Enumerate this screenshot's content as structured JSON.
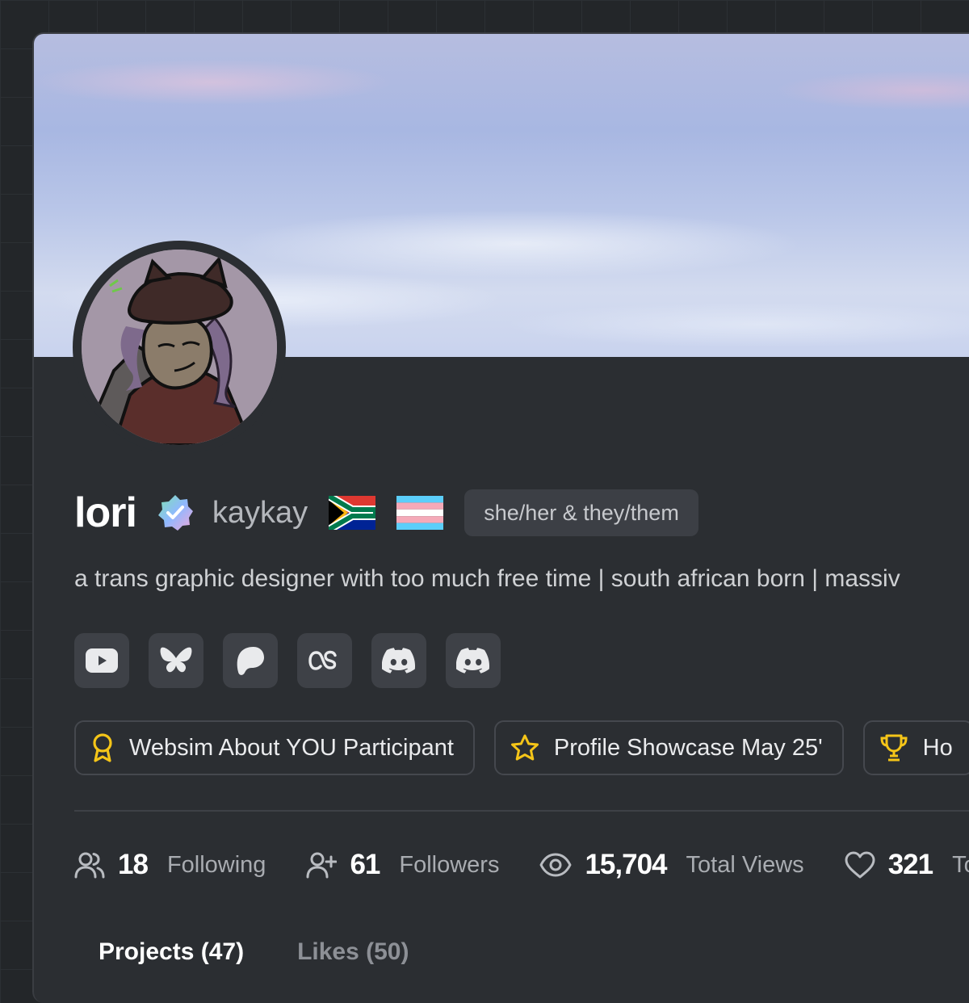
{
  "profile": {
    "display_name": "lori",
    "username": "kaykay",
    "pronouns": "she/her & they/them",
    "bio": "a trans graphic designer with too much free time | south african born | massiv",
    "verified_icon": "verified-badge-icon",
    "flags": [
      "south-africa-flag-icon",
      "transgender-flag-icon"
    ]
  },
  "socials": [
    {
      "name": "youtube-icon"
    },
    {
      "name": "bluesky-icon"
    },
    {
      "name": "patreon-icon"
    },
    {
      "name": "lastfm-icon"
    },
    {
      "name": "discord-icon"
    },
    {
      "name": "discord-icon"
    }
  ],
  "badges": [
    {
      "icon": "award-ribbon-icon",
      "label": "Websim About YOU Participant",
      "color": "#f5c518"
    },
    {
      "icon": "star-icon",
      "label": "Profile Showcase May 25'",
      "color": "#f5c518"
    },
    {
      "icon": "trophy-icon",
      "label": "Ho",
      "color": "#f5c518"
    }
  ],
  "stats": [
    {
      "icon": "users-icon",
      "value": "18",
      "label": "Following"
    },
    {
      "icon": "user-plus-icon",
      "value": "61",
      "label": "Followers"
    },
    {
      "icon": "eye-icon",
      "value": "15,704",
      "label": "Total Views"
    },
    {
      "icon": "heart-icon",
      "value": "321",
      "label": "To"
    }
  ],
  "tabs": [
    {
      "label": "Projects (47)",
      "active": true
    },
    {
      "label": "Likes (50)",
      "active": false
    }
  ],
  "colors": {
    "background": "#232629",
    "card": "#2b2e32",
    "chip": "#3e4147",
    "accent_gold": "#f5c518"
  }
}
